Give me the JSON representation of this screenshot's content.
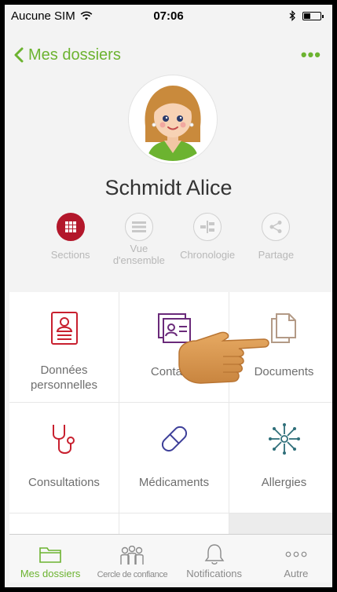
{
  "status_bar": {
    "carrier": "Aucune SIM",
    "time": "07:06",
    "battery_level": 0.35
  },
  "nav": {
    "back_label": "Mes dossiers",
    "more_label": "•••"
  },
  "profile": {
    "name": "Schmidt Alice"
  },
  "modes": [
    {
      "label": "Sections",
      "icon": "grid-icon",
      "active": true
    },
    {
      "label": "Vue\nd'ensemble",
      "icon": "list-icon",
      "active": false
    },
    {
      "label": "Chronologie",
      "icon": "timeline-icon",
      "active": false
    },
    {
      "label": "Partage",
      "icon": "share-icon",
      "active": false
    }
  ],
  "tiles": [
    {
      "label": "Données\npersonnelles",
      "icon": "personal-data-icon",
      "color": "#c8202f"
    },
    {
      "label": "Contacts",
      "icon": "contacts-icon",
      "color": "#6a2a7a"
    },
    {
      "label": "Documents",
      "icon": "documents-icon",
      "color": "#b39a86"
    },
    {
      "label": "Consultations",
      "icon": "stethoscope-icon",
      "color": "#c8202f"
    },
    {
      "label": "Médicaments",
      "icon": "pill-icon",
      "color": "#3d3f99"
    },
    {
      "label": "Allergies",
      "icon": "allergen-icon",
      "color": "#2f6f7a"
    }
  ],
  "tab_bar": [
    {
      "label": "Mes dossiers",
      "icon": "folder-icon",
      "active": true
    },
    {
      "label": "Cercle de confiance",
      "icon": "people-icon",
      "active": false
    },
    {
      "label": "Notifications",
      "icon": "bell-icon",
      "active": false
    },
    {
      "label": "Autre",
      "icon": "more-dots-icon",
      "active": false
    }
  ],
  "colors": {
    "accent": "#6cb330",
    "active_mode": "#b3172b"
  }
}
